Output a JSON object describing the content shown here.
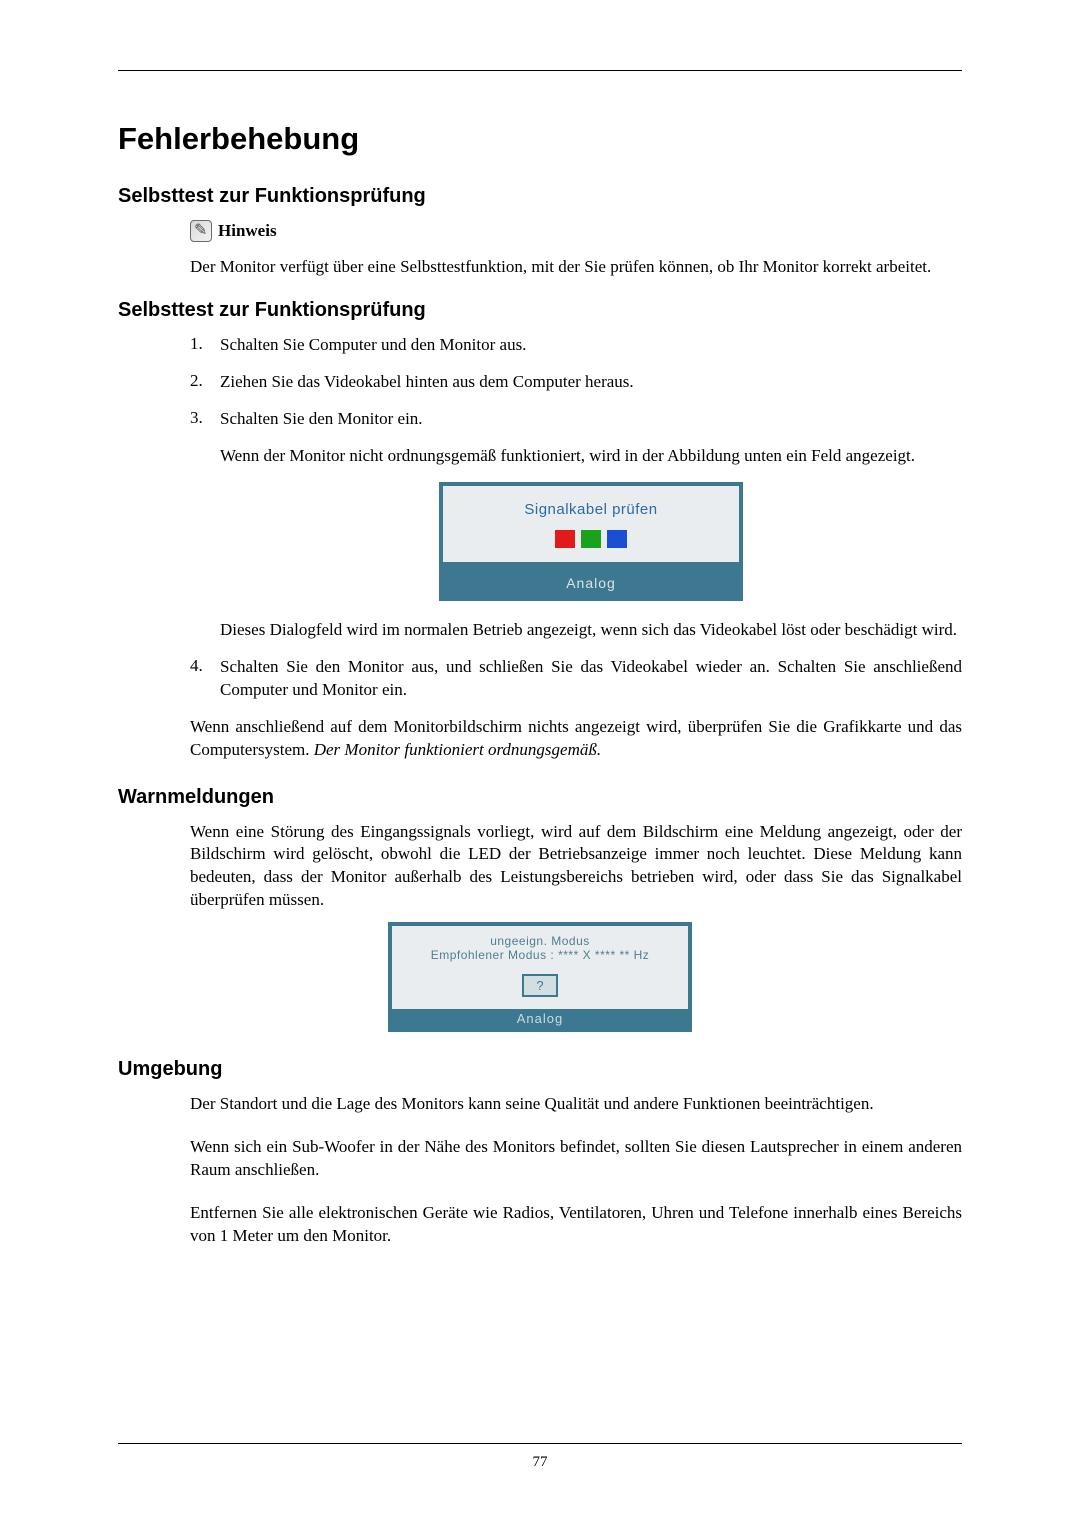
{
  "title": "Fehlerbehebung",
  "section1": {
    "heading": "Selbsttest zur Funktionsprüfung",
    "note_label": "Hinweis",
    "note_text": "Der Monitor verfügt über eine Selbsttestfunktion, mit der Sie prüfen können, ob Ihr Monitor korrekt arbeitet."
  },
  "section2": {
    "heading": "Selbsttest zur Funktionsprüfung",
    "items": [
      {
        "num": "1.",
        "text": "Schalten Sie Computer und den Monitor aus."
      },
      {
        "num": "2.",
        "text": "Ziehen Sie das Videokabel hinten aus dem Computer heraus."
      },
      {
        "num": "3.",
        "text": "Schalten Sie den Monitor ein.",
        "para_after1": "Wenn der Monitor nicht ordnungsgemäß funktioniert, wird in der Abbildung unten ein Feld angezeigt.",
        "para_after2": "Dieses Dialogfeld wird im normalen Betrieb angezeigt, wenn sich das Videokabel löst oder beschädigt wird."
      },
      {
        "num": "4.",
        "text": "Schalten Sie den Monitor aus, und schließen Sie das Videokabel wieder an. Schalten Sie anschließend Computer und Monitor ein."
      }
    ],
    "trailer_plain": "Wenn anschließend auf dem Monitorbildschirm nichts angezeigt wird, überprüfen Sie die Grafikkarte und das Computersystem. ",
    "trailer_italic": "Der Monitor funktioniert ordnungsgemäß."
  },
  "dialog1": {
    "message": "Signalkabel prüfen",
    "footer": "Analog"
  },
  "section3": {
    "heading": "Warnmeldungen",
    "text": "Wenn eine Störung des Eingangssignals vorliegt, wird auf dem Bildschirm eine Meldung angezeigt, oder der Bildschirm wird gelöscht, obwohl die LED der Betriebsanzeige immer noch leuchtet. Diese Meldung kann bedeuten, dass der Monitor außerhalb des Leistungsbereichs betrieben wird, oder dass Sie das Signalkabel überprüfen müssen."
  },
  "dialog2": {
    "line1": "ungeeign. Modus",
    "line2": "Empfohlener Modus :  **** X **** ** Hz",
    "button": "?",
    "footer": "Analog"
  },
  "section4": {
    "heading": "Umgebung",
    "p1": "Der Standort und die Lage des Monitors kann seine Qualität und andere Funktionen beeinträchtigen.",
    "p2": "Wenn sich ein Sub-Woofer in der Nähe des Monitors befindet, sollten Sie diesen Lautsprecher in einem anderen Raum anschließen.",
    "p3": "Entfernen Sie alle elektronischen Geräte wie Radios, Ventilatoren, Uhren und Telefone innerhalb eines Bereichs von 1 Meter um den Monitor."
  },
  "page_number": "77"
}
